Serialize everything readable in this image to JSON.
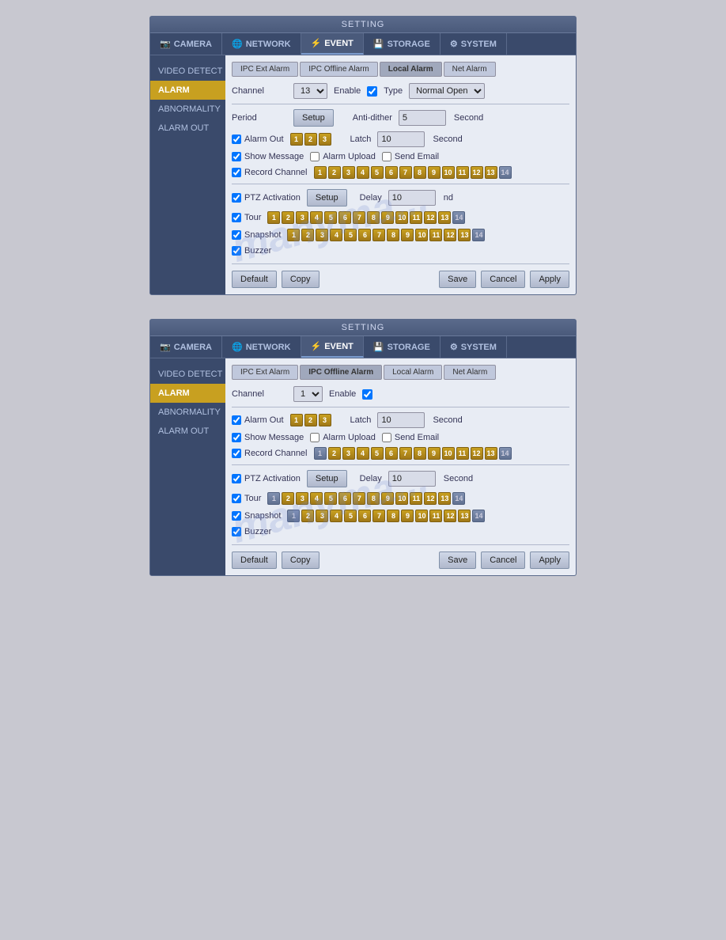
{
  "panel1": {
    "title": "SETTING",
    "tabs": [
      {
        "id": "camera",
        "label": "CAMERA",
        "icon": "📷"
      },
      {
        "id": "network",
        "label": "NETWORK",
        "icon": "🌐"
      },
      {
        "id": "event",
        "label": "EVENT",
        "icon": "⚡",
        "active": true
      },
      {
        "id": "storage",
        "label": "STORAGE",
        "icon": "💾"
      },
      {
        "id": "system",
        "label": "SYSTEM",
        "icon": "⚙"
      }
    ],
    "sidebar": [
      {
        "id": "video_detect",
        "label": "VIDEO DETECT"
      },
      {
        "id": "alarm",
        "label": "ALARM",
        "active": true
      },
      {
        "id": "abnormality",
        "label": "ABNORMALITY"
      },
      {
        "id": "alarm_out",
        "label": "ALARM OUT"
      }
    ],
    "alarm_tabs": [
      {
        "id": "ipc_ext",
        "label": "IPC Ext Alarm"
      },
      {
        "id": "ipc_offline",
        "label": "IPC Offline Alarm"
      },
      {
        "id": "local",
        "label": "Local Alarm",
        "active": true
      },
      {
        "id": "net",
        "label": "Net Alarm"
      }
    ],
    "channel_label": "Channel",
    "channel_value": "13",
    "enable_label": "Enable",
    "type_label": "Type",
    "type_value": "Normal Open",
    "period_label": "Period",
    "setup_label": "Setup",
    "anti_dither_label": "Anti-dither",
    "anti_dither_value": "5",
    "second_label": "Second",
    "latch_label": "Latch",
    "latch_value": "10",
    "alarm_out_label": "Alarm Out",
    "show_message_label": "Show Message",
    "alarm_upload_label": "Alarm Upload",
    "send_email_label": "Send Email",
    "record_channel_label": "Record Channel",
    "ptz_activation_label": "PTZ Activation",
    "delay_label": "Delay",
    "delay_value": "10",
    "tour_label": "Tour",
    "snapshot_label": "Snapshot",
    "buzzer_label": "Buzzer",
    "default_label": "Default",
    "copy_label": "Copy",
    "save_label": "Save",
    "cancel_label": "Cancel",
    "apply_label": "Apply",
    "channels_1_3": [
      "1",
      "2",
      "3"
    ],
    "channels_all": [
      "1",
      "2",
      "3",
      "4",
      "5",
      "6",
      "7",
      "8",
      "9",
      "10",
      "11",
      "12",
      "13",
      "14"
    ],
    "watermark": "manyma..."
  },
  "panel2": {
    "title": "SETTING",
    "tabs": [
      {
        "id": "camera",
        "label": "CAMERA",
        "icon": "📷"
      },
      {
        "id": "network",
        "label": "NETWORK",
        "icon": "🌐"
      },
      {
        "id": "event",
        "label": "EVENT",
        "icon": "⚡",
        "active": true
      },
      {
        "id": "storage",
        "label": "STORAGE",
        "icon": "💾"
      },
      {
        "id": "system",
        "label": "SYSTEM",
        "icon": "⚙"
      }
    ],
    "sidebar": [
      {
        "id": "video_detect",
        "label": "VIDEO DETECT"
      },
      {
        "id": "alarm",
        "label": "ALARM",
        "active": true
      },
      {
        "id": "abnormality",
        "label": "ABNORMALITY"
      },
      {
        "id": "alarm_out",
        "label": "ALARM OUT"
      }
    ],
    "alarm_tabs": [
      {
        "id": "ipc_ext",
        "label": "IPC Ext Alarm"
      },
      {
        "id": "ipc_offline",
        "label": "IPC Offline Alarm",
        "active": true
      },
      {
        "id": "local",
        "label": "Local Alarm"
      },
      {
        "id": "net",
        "label": "Net Alarm"
      }
    ],
    "channel_label": "Channel",
    "channel_value": "1",
    "enable_label": "Enable",
    "latch_label": "Latch",
    "latch_value": "10",
    "second_label": "Second",
    "alarm_out_label": "Alarm Out",
    "show_message_label": "Show Message",
    "alarm_upload_label": "Alarm Upload",
    "send_email_label": "Send Email",
    "record_channel_label": "Record Channel",
    "ptz_activation_label": "PTZ Activation",
    "setup_label": "Setup",
    "delay_label": "Delay",
    "delay_value": "10",
    "tour_label": "Tour",
    "snapshot_label": "Snapshot",
    "buzzer_label": "Buzzer",
    "default_label": "Default",
    "copy_label": "Copy",
    "save_label": "Save",
    "cancel_label": "Cancel",
    "apply_label": "Apply",
    "channels_1_3": [
      "1",
      "2",
      "3"
    ],
    "channels_all": [
      "1",
      "2",
      "3",
      "4",
      "5",
      "6",
      "7",
      "8",
      "9",
      "10",
      "11",
      "12",
      "13",
      "14"
    ],
    "watermark": "manyma..."
  }
}
